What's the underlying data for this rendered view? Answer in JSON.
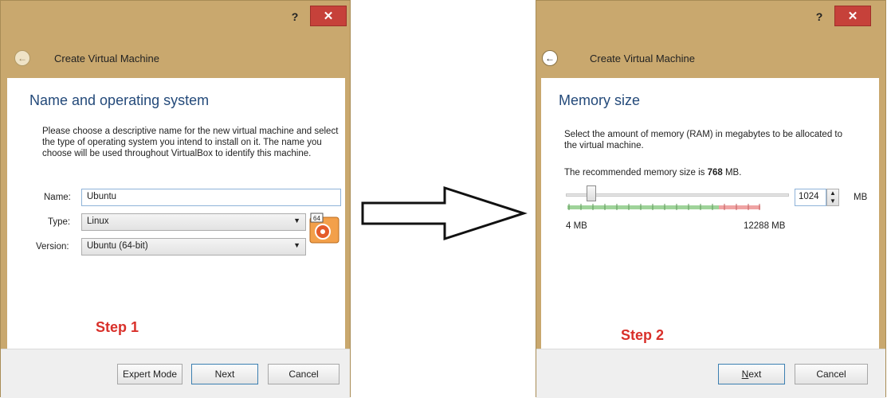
{
  "dialog1": {
    "help_label": "?",
    "close_label": "✕",
    "back_icon": "back-arrow-icon",
    "title": "Create Virtual Machine",
    "section_title": "Name and operating system",
    "description": "Please choose a descriptive name for the new virtual machine and select the type of operating system you intend to install on it. The name you choose will be used throughout VirtualBox to identify this machine.",
    "name_label": "Name:",
    "name_value": "Ubuntu",
    "type_label": "Type:",
    "type_value": "Linux",
    "version_label": "Version:",
    "version_value": "Ubuntu (64-bit)",
    "os_icon_badge": "64",
    "step_label": "Step 1",
    "buttons": {
      "expert": "Expert Mode",
      "next": "Next",
      "cancel": "Cancel"
    }
  },
  "dialog2": {
    "help_label": "?",
    "close_label": "✕",
    "back_icon": "back-arrow-icon",
    "title": "Create Virtual Machine",
    "section_title": "Memory size",
    "description": "Select the amount of memory (RAM) in megabytes to be allocated to the virtual machine.",
    "recommended_prefix": "The recommended memory size is ",
    "recommended_value": "768",
    "recommended_suffix": " MB.",
    "memory_value": "1024",
    "memory_unit": "MB",
    "slider_min_label": "4 MB",
    "slider_max_label": "12288 MB",
    "step_label": "Step 2",
    "buttons": {
      "next_prefix": "N",
      "next_rest": "ext",
      "cancel": "Cancel"
    }
  },
  "colors": {
    "dialog_frame": "#c9a86e",
    "close_button": "#c6413a",
    "section_title": "#244a7a",
    "step_text": "#d9302a",
    "slider_green": "#9fd39a",
    "slider_red": "#efa3a3"
  }
}
